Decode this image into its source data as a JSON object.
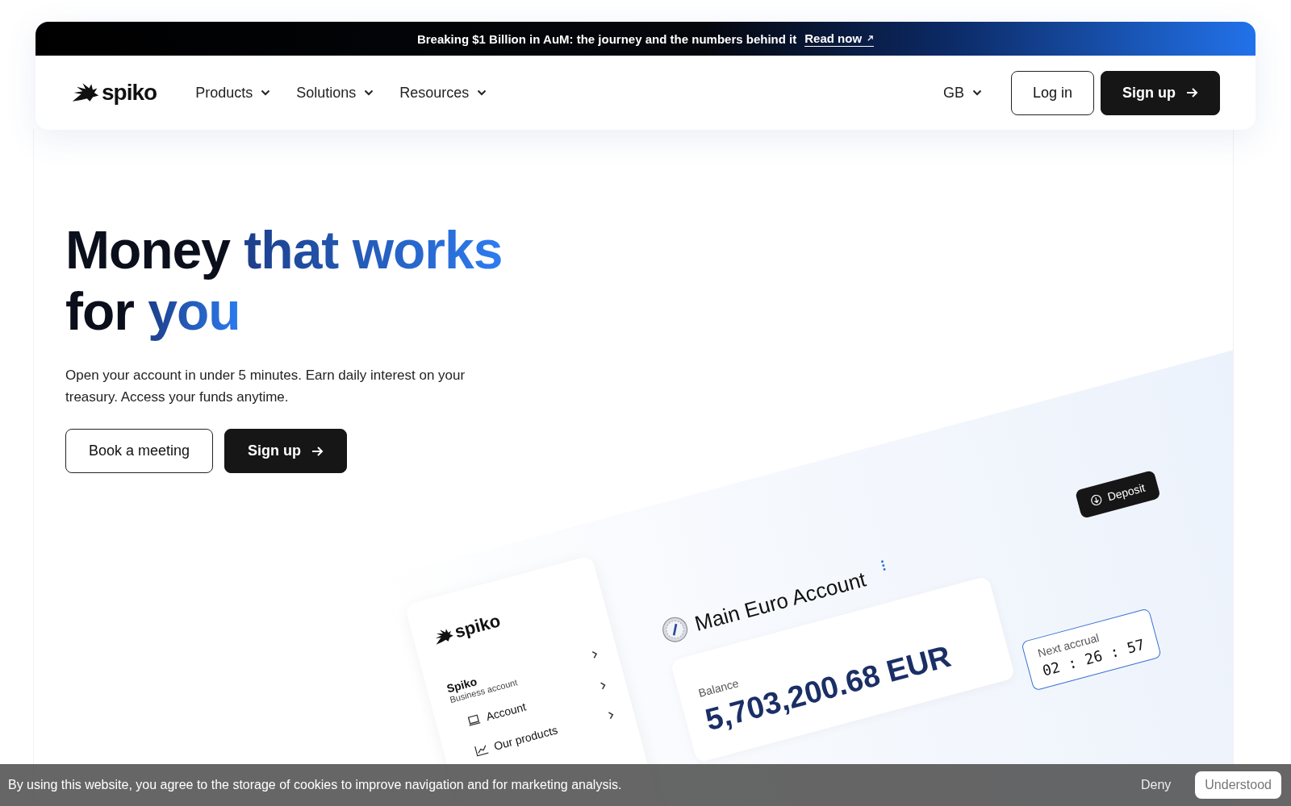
{
  "banner": {
    "text": "Breaking $1 Billion in AuM: the journey and the numbers behind it",
    "link": "Read now"
  },
  "nav": {
    "logo": "spiko",
    "items": [
      {
        "label": "Products"
      },
      {
        "label": "Solutions"
      },
      {
        "label": "Resources"
      }
    ],
    "language": "GB",
    "login": "Log in",
    "signup": "Sign up"
  },
  "hero": {
    "heading": [
      [
        {
          "text": "Money",
          "accent": false
        },
        {
          "text": "that works",
          "accent": true
        }
      ],
      [
        {
          "text": "for",
          "accent": false
        },
        {
          "text": "you",
          "accent": true
        }
      ]
    ],
    "text": "Open your account in under 5 minutes. Earn daily interest on your treasury. Access your funds anytime.",
    "buttons": [
      {
        "label": "Book a meeting",
        "kind": "outline"
      },
      {
        "label": "Sign up",
        "kind": "primary"
      }
    ]
  },
  "mockup": {
    "logo": "spiko",
    "org": "Spiko",
    "org_type": "Business account",
    "menu": [
      {
        "label": "Account",
        "kind": "laptop"
      },
      {
        "label": "Our products",
        "kind": "chart"
      }
    ],
    "deposit": "Deposit",
    "account_title": "Main Euro Account",
    "balance_label": "Balance",
    "balance": "5,703,200.68 EUR",
    "accrual_label": "Next accrual",
    "accrual": "02 : 26 : 57"
  },
  "cookie": {
    "text": "By using this website, you agree to the storage of cookies to improve navigation and for marketing analysis.",
    "deny": "Deny",
    "accept": "Understood"
  }
}
